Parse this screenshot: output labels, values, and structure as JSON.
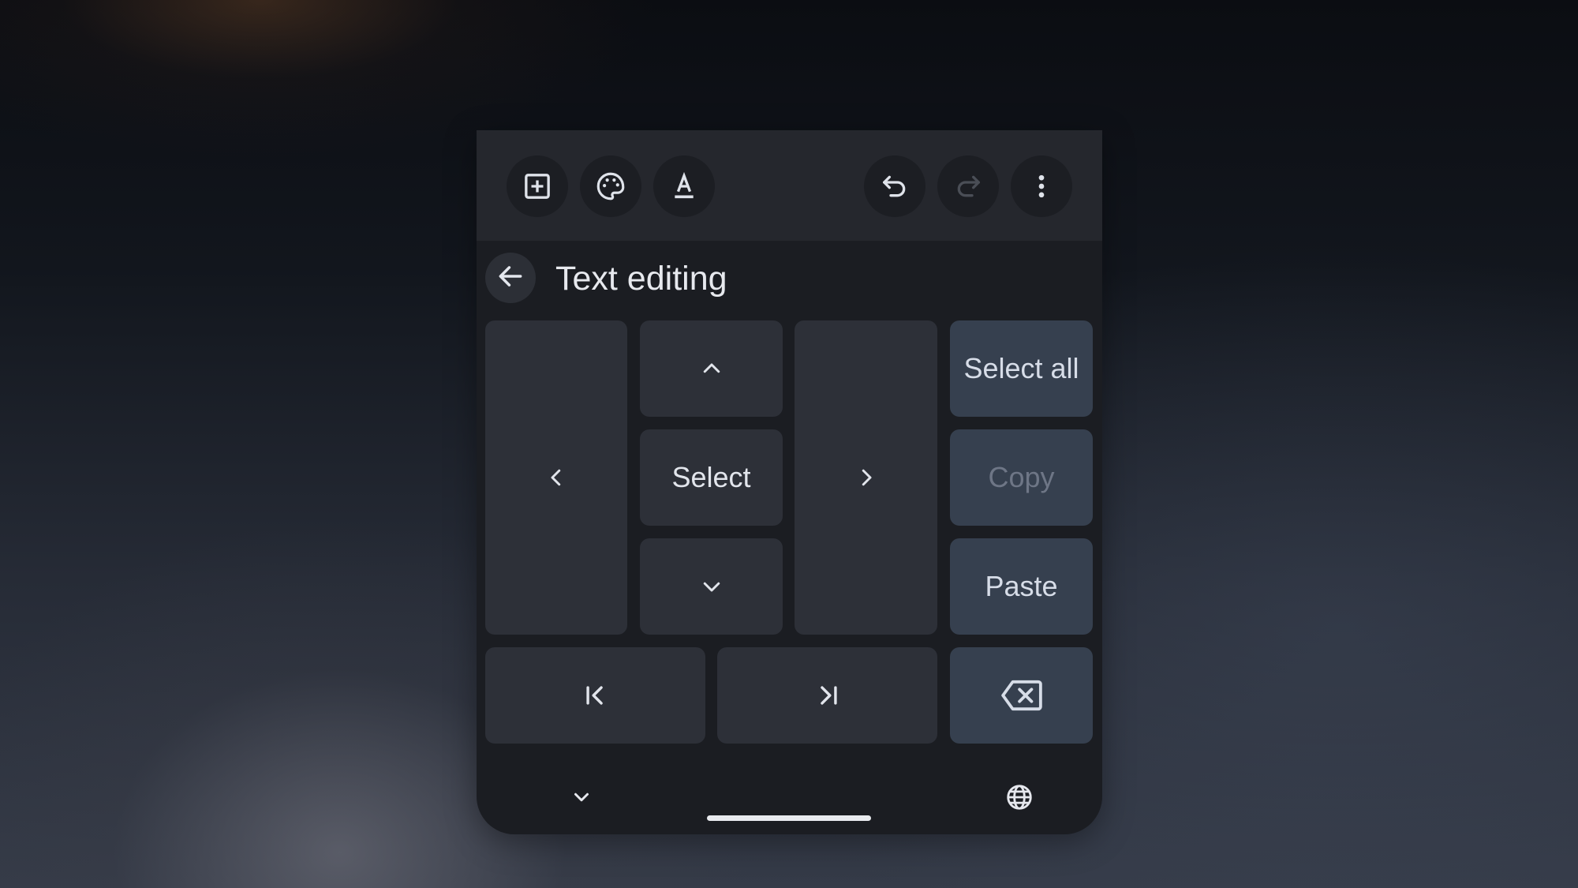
{
  "toolbar": {
    "buttons": [
      {
        "icon": "add-box-icon"
      },
      {
        "icon": "palette-icon"
      },
      {
        "icon": "text-format-icon"
      },
      {
        "icon": "undo-icon"
      },
      {
        "icon": "redo-icon",
        "disabled": true
      },
      {
        "icon": "more-vert-icon"
      }
    ]
  },
  "header": {
    "back_icon": "arrow-back-icon",
    "title": "Text editing"
  },
  "keys": {
    "select_label": "Select",
    "select_all_label": "Select all",
    "copy_label": "Copy",
    "copy_disabled": true,
    "paste_label": "Paste",
    "icons": {
      "up": "chevron-up-icon",
      "down": "chevron-down-icon",
      "left": "chevron-left-icon",
      "right": "chevron-right-icon",
      "line_start": "line-start-icon",
      "line_end": "line-end-icon",
      "backspace": "backspace-icon"
    }
  },
  "bottom": {
    "hide_keyboard_icon": "chevron-down-icon",
    "language_icon": "globe-icon"
  },
  "colors": {
    "panel": "#1b1d22",
    "toolbar": "#25272d",
    "key": "#2d3038",
    "action_key": "#36404f",
    "text": "#e2e5ec"
  }
}
